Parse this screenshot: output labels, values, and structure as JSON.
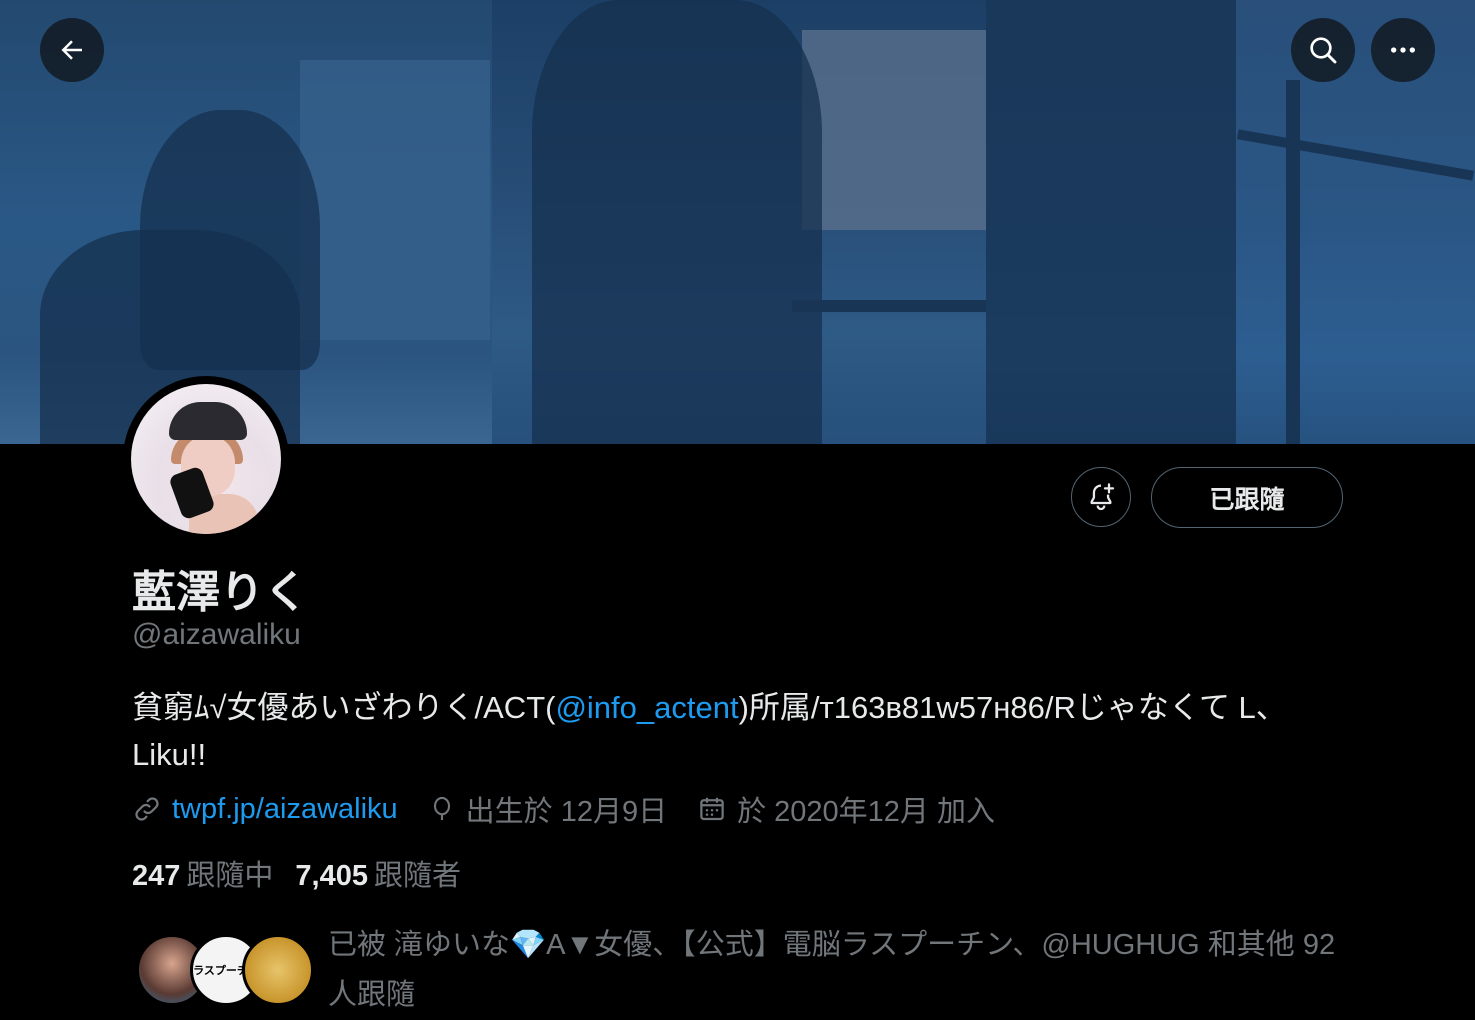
{
  "header": {
    "back_icon": "arrow-left-icon",
    "search_icon": "search-icon",
    "more_icon": "more-horizontal-icon"
  },
  "profile": {
    "display_name": "藍澤りく",
    "handle": "@aizawaliku",
    "bio_before": "貧窮ﾑ√女優あいざわりく/ACT(",
    "bio_mention": "@info_actent",
    "bio_after": ")所属/т163в81w57н86/Rじゃなくて L、Liku!!",
    "website": "twpf.jp/aizawaliku",
    "birthday": "出生於 12月9日",
    "joined": "於 2020年12月 加入"
  },
  "actions": {
    "notify_icon": "bell-plus-icon",
    "follow_label": "已跟隨"
  },
  "stats": {
    "following_count": "247",
    "following_label": "跟隨中",
    "followers_count": "7,405",
    "followers_label": "跟隨者"
  },
  "followed_by": {
    "text": "已被 滝ゆいな💎A▼女優、【公式】電脳ラスプーチン、@HUGHUG 和其他 92 人跟隨",
    "avatar2_text": "ラスプーチン"
  },
  "colors": {
    "background": "#000000",
    "text": "#e7e9ea",
    "secondary": "#71767b",
    "accent": "#1d9bf0",
    "border": "#536471"
  }
}
